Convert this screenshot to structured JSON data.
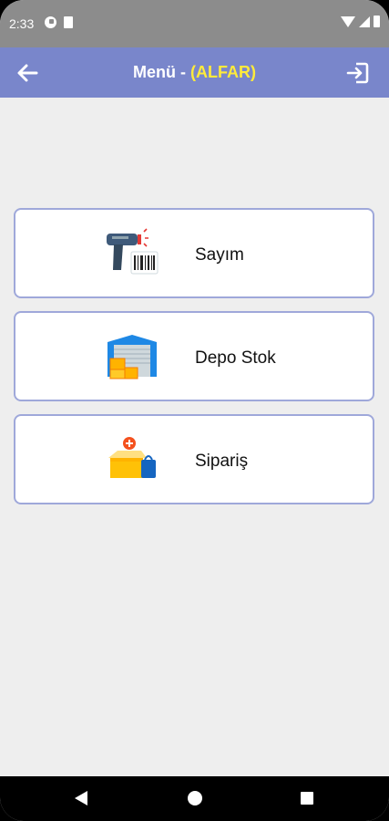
{
  "status_bar": {
    "time": "2:33"
  },
  "app_bar": {
    "title": "Menü - ",
    "title_accent": "(ALFAR)",
    "back_icon": "arrow-left-icon",
    "logout_icon": "logout-icon",
    "background": "#7986cb",
    "accent_color": "#ffeb3b"
  },
  "menu": {
    "items": [
      {
        "label": "Sayım",
        "icon": "barcode-scanner-icon"
      },
      {
        "label": "Depo Stok",
        "icon": "warehouse-icon"
      },
      {
        "label": "Sipariş",
        "icon": "order-box-icon"
      }
    ]
  },
  "nav_bar": {
    "icons": [
      "nav-back-icon",
      "nav-home-icon",
      "nav-recents-icon"
    ]
  }
}
